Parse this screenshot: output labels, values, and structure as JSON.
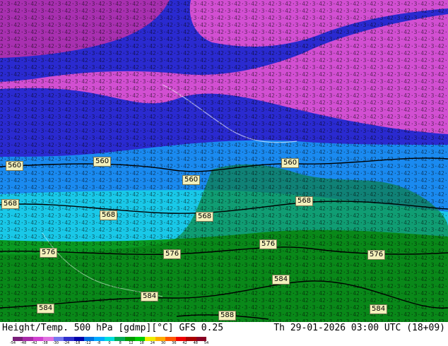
{
  "map": {
    "product": "Height/Temp. 500 hPa [gdmp][°C] GFS 0.25",
    "valid_time": "Th 29-01-2026 03:00 UTC (18+09)",
    "contour_labels": [
      "560",
      "560",
      "560",
      "560",
      "568",
      "568",
      "568",
      "568",
      "576",
      "576",
      "576",
      "576",
      "584",
      "584",
      "584",
      "584",
      "588"
    ],
    "colorbar": {
      "ticks": [
        "-54",
        "-48",
        "-42",
        "-38",
        "-30",
        "-24",
        "-18",
        "-12",
        "-8",
        "0",
        "8",
        "12",
        "18",
        "24",
        "30",
        "36",
        "42",
        "48",
        "54"
      ],
      "colors": [
        "#7a1e7a",
        "#a82aa8",
        "#d040d0",
        "#e070e0",
        "#7777ee",
        "#3030cc",
        "#0000aa",
        "#0070e0",
        "#00aaff",
        "#00dddd",
        "#00aa55",
        "#009900",
        "#00cc00",
        "#eeee00",
        "#ffaa00",
        "#ff5500",
        "#ee0000",
        "#aa0000",
        "#880022"
      ]
    },
    "colors": {
      "cold_magenta": "#d24fd2",
      "dark_magenta": "#a830b0",
      "blue": "#2a2ad0",
      "light_blue": "#1a8af0",
      "cyan": "#19c8e8",
      "green": "#0a9a22",
      "dark_green": "#0a7a12",
      "label_bg": "#f3f0bb"
    }
  }
}
